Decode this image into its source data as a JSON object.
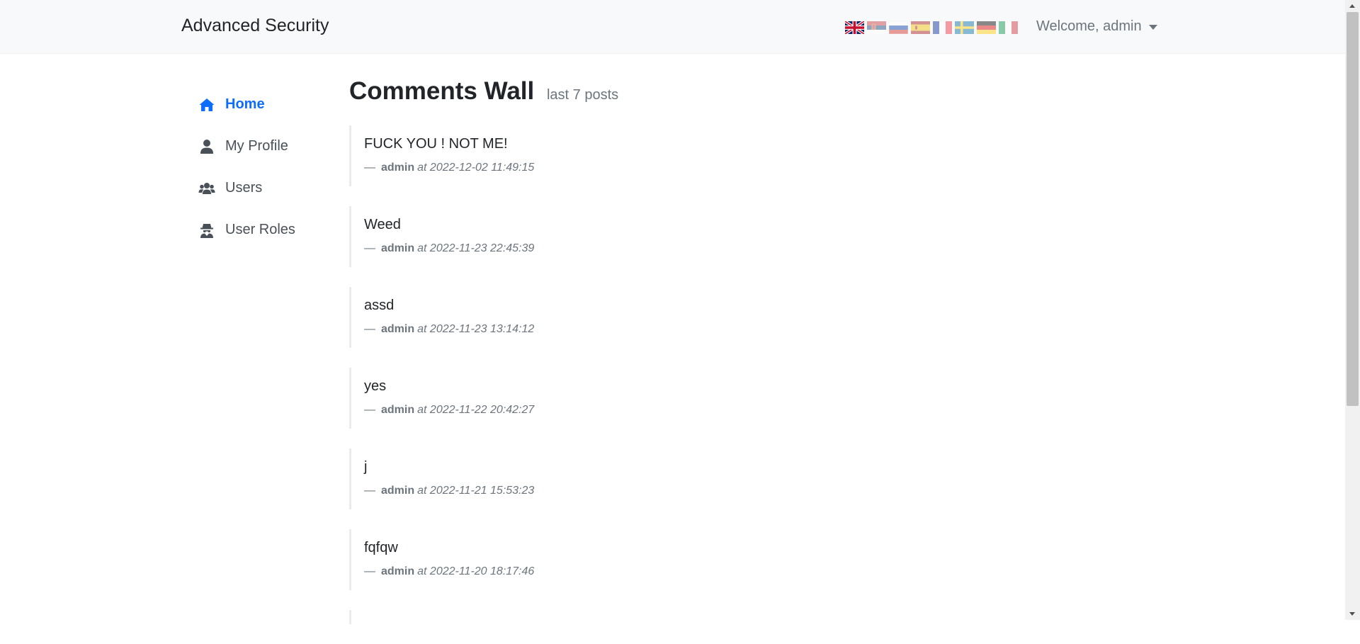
{
  "navbar": {
    "brand": "Advanced Security",
    "welcome": "Welcome, admin",
    "languages": [
      {
        "code": "en",
        "icon": "uk-flag-icon"
      },
      {
        "code": "sr",
        "icon": "serbia-flag-icon"
      },
      {
        "code": "ru",
        "icon": "russia-flag-icon"
      },
      {
        "code": "es",
        "icon": "spain-flag-icon"
      },
      {
        "code": "fr",
        "icon": "france-flag-icon"
      },
      {
        "code": "se",
        "icon": "sweden-flag-icon"
      },
      {
        "code": "de",
        "icon": "germany-flag-icon"
      },
      {
        "code": "it",
        "icon": "italy-flag-icon"
      }
    ]
  },
  "sidebar": {
    "items": [
      {
        "label": "Home",
        "icon": "home-icon",
        "active": true
      },
      {
        "label": "My Profile",
        "icon": "user-icon",
        "active": false
      },
      {
        "label": "Users",
        "icon": "users-icon",
        "active": false
      },
      {
        "label": "User Roles",
        "icon": "user-secret-icon",
        "active": false
      }
    ]
  },
  "main": {
    "title": "Comments Wall",
    "subtitle": "last 7 posts",
    "posts": [
      {
        "text": "FUCK YOU ! NOT ME!",
        "dash": "—",
        "author": "admin",
        "at": "at 2022-12-02 11:49:15"
      },
      {
        "text": "Weed",
        "dash": "—",
        "author": "admin",
        "at": "at 2022-11-23 22:45:39"
      },
      {
        "text": "assd",
        "dash": "—",
        "author": "admin",
        "at": "at 2022-11-23 13:14:12"
      },
      {
        "text": "yes",
        "dash": "—",
        "author": "admin",
        "at": "at 2022-11-22 20:42:27"
      },
      {
        "text": "j",
        "dash": "—",
        "author": "admin",
        "at": "at 2022-11-21 15:53:23"
      },
      {
        "text": "fqfqw",
        "dash": "—",
        "author": "admin",
        "at": "at 2022-11-20 18:17:46"
      }
    ]
  },
  "colors": {
    "accent": "#0d6efd",
    "muted": "#6c757d",
    "navbar_bg": "#f8f9fa"
  }
}
